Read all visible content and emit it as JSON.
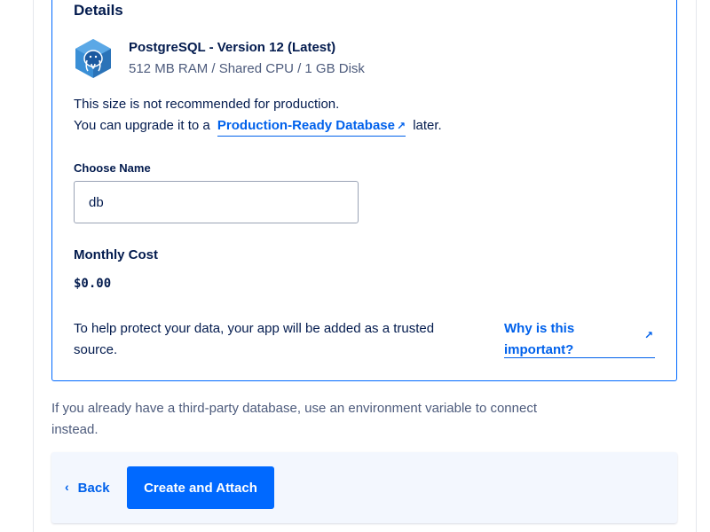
{
  "details": {
    "title": "Details",
    "db_name": "PostgreSQL - Version 12 (Latest)",
    "db_specs": "512 MB RAM / Shared CPU / 1 GB Disk",
    "logo_icon": "postgresql-elephant-icon"
  },
  "warning": {
    "line1": "This size is not recommended for production.",
    "line2_prefix": "You can upgrade it to a",
    "link_label": "Production-Ready Database",
    "line2_suffix": "later."
  },
  "name_field": {
    "label": "Choose Name",
    "value": "db"
  },
  "cost": {
    "label": "Monthly Cost",
    "value": "$0.00"
  },
  "trusted_source": {
    "text": "To help protect your data, your app will be added as a trusted source.",
    "link_label": "Why is this important?"
  },
  "third_party_note": "If you already have a third-party database, use an environment variable to connect instead.",
  "footer": {
    "back_label": "Back",
    "create_label": "Create and Attach"
  },
  "colors": {
    "accent": "#0069ff",
    "link": "#0061eb",
    "text": "#031b4e",
    "muted": "#4d5b7c",
    "footer_bg": "#f3f7fe"
  }
}
